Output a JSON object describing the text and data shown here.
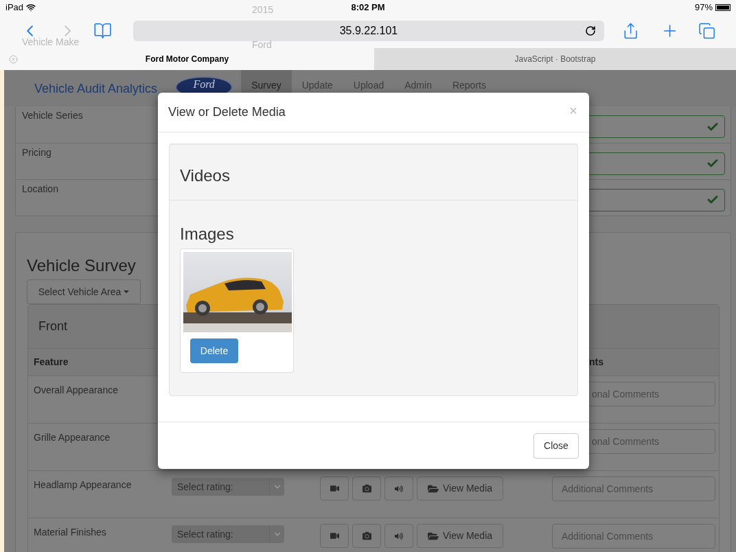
{
  "status_bar": {
    "device": "iPad",
    "time": "8:02 PM",
    "battery": "97%"
  },
  "behind_toolbar": {
    "year_value": "2015",
    "make_label": "Vehicle Make",
    "make_value": "Ford"
  },
  "browser": {
    "url": "35.9.22.101",
    "tabs": [
      {
        "label": "Ford Motor Company",
        "selected": true
      },
      {
        "label": "JavaScript · Bootstrap",
        "selected": false
      }
    ]
  },
  "navbar": {
    "brand": "Vehicle Audit Analytics",
    "logo_text": "Ford",
    "items": [
      {
        "label": "Survey",
        "selected": true
      },
      {
        "label": "Update",
        "selected": false
      },
      {
        "label": "Upload",
        "selected": false
      },
      {
        "label": "Admin",
        "selected": false
      },
      {
        "label": "Reports",
        "selected": false
      }
    ]
  },
  "vehicle_fields": [
    {
      "label": "Vehicle Series",
      "valid": true
    },
    {
      "label": "Pricing",
      "valid": true
    },
    {
      "label": "Location",
      "valid": true
    }
  ],
  "survey": {
    "title": "Vehicle Survey",
    "area_button": "Select Vehicle Area",
    "section": "Front",
    "columns": [
      "Feature",
      "nts"
    ],
    "rows": [
      {
        "kind": "covered",
        "feature": "Overall Appearance",
        "comments_placeholder": "onal Comments"
      },
      {
        "kind": "covered",
        "feature": "Grille Appearance",
        "comments_placeholder": "onal Comments"
      },
      {
        "kind": "full",
        "feature": "Headlamp Appearance",
        "rating_placeholder": "Select rating:",
        "view_media": "View Media",
        "comments_placeholder": "Additional Comments"
      },
      {
        "kind": "full",
        "feature": "Material Finishes",
        "rating_placeholder": "Select rating:",
        "view_media": "View Media",
        "comments_placeholder": "Additional Comments"
      }
    ]
  },
  "modal": {
    "title": "View or Delete Media",
    "close_symbol": "×",
    "videos_heading": "Videos",
    "images_heading": "Images",
    "images": [
      {
        "delete_label": "Delete"
      }
    ],
    "footer_button": "Close"
  }
}
